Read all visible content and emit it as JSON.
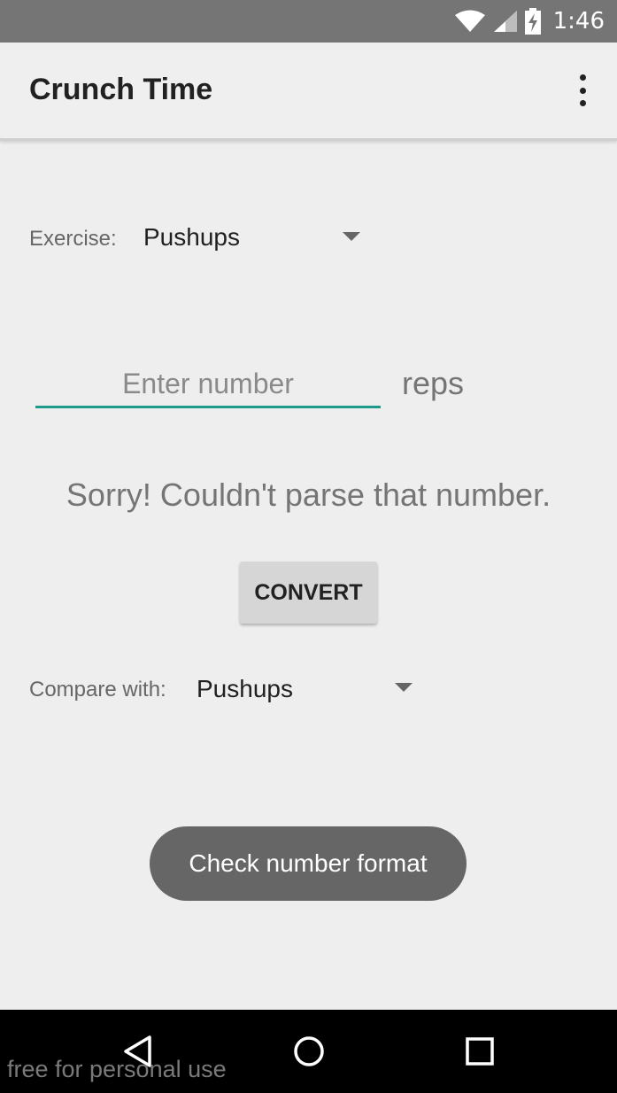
{
  "status_bar": {
    "time": "1:46",
    "icons": [
      "wifi-icon",
      "signal-icon",
      "battery-charging-icon"
    ]
  },
  "app_bar": {
    "title": "Crunch Time",
    "overflow_icon": "more-vert-icon"
  },
  "exercise": {
    "label": "Exercise:",
    "value": "Pushups"
  },
  "reps_input": {
    "placeholder": "Enter number",
    "value": "",
    "unit": "reps"
  },
  "error_message": "Sorry! Couldn't parse that number.",
  "convert_button": {
    "label": "CONVERT"
  },
  "compare": {
    "label": "Compare with:",
    "value": "Pushups"
  },
  "toast": {
    "message": "Check number format"
  },
  "nav_bar": {
    "buttons": [
      "back-icon",
      "home-icon",
      "recents-icon"
    ]
  },
  "watermark": "free for personal use",
  "colors": {
    "accent": "#1f9a8a",
    "status_bar": "#757575",
    "toast": "#666666"
  }
}
